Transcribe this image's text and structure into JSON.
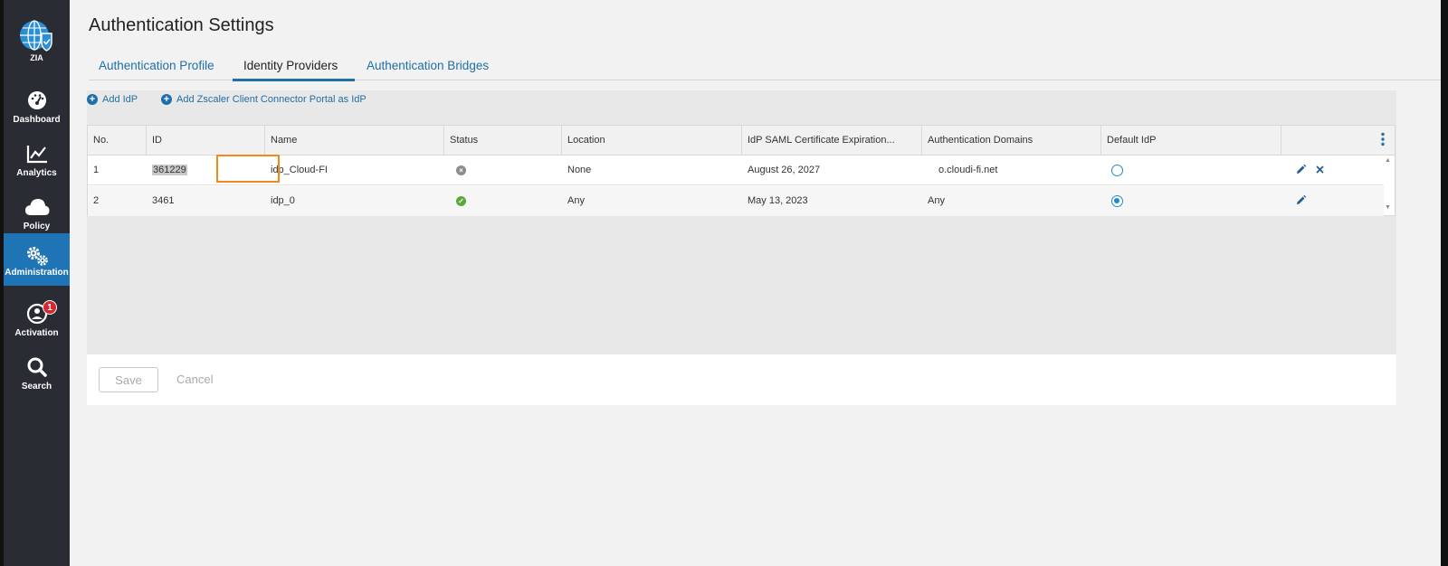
{
  "sidebar": {
    "logo_label": "ZIA",
    "items": [
      {
        "label": "Dashboard"
      },
      {
        "label": "Analytics"
      },
      {
        "label": "Policy"
      },
      {
        "label": "Administration"
      },
      {
        "label": "Activation",
        "badge": "1"
      },
      {
        "label": "Search"
      }
    ],
    "active_color": "#1f74b5"
  },
  "page": {
    "title": "Authentication Settings"
  },
  "tabs": [
    {
      "label": "Authentication Profile",
      "active": false
    },
    {
      "label": "Identity Providers",
      "active": true
    },
    {
      "label": "Authentication Bridges",
      "active": false
    }
  ],
  "actions": {
    "add_idp": "Add IdP",
    "add_connector": "Add Zscaler Client Connector Portal as IdP"
  },
  "table": {
    "columns": [
      "No.",
      "ID",
      "Name",
      "Status",
      "Location",
      "IdP SAML Certificate Expiration...",
      "Authentication Domains",
      "Default IdP"
    ],
    "rows": [
      {
        "no": "1",
        "id": "361229",
        "name": "idp_Cloud-FI",
        "status": "disabled",
        "location": "None",
        "expiration": "August 26, 2027",
        "domains": "o.cloudi-fi.net",
        "default": false
      },
      {
        "no": "2",
        "id": "3461",
        "name": "idp_0",
        "status": "enabled",
        "location": "Any",
        "expiration": "May 13, 2023",
        "domains": "Any",
        "default": true
      }
    ]
  },
  "footer": {
    "save_label": "Save",
    "cancel_label": "Cancel"
  },
  "colors": {
    "link": "#1f6fa8",
    "highlight": "#f28a1b",
    "status_enabled": "#5aa936",
    "status_disabled": "#8c8c8c"
  }
}
